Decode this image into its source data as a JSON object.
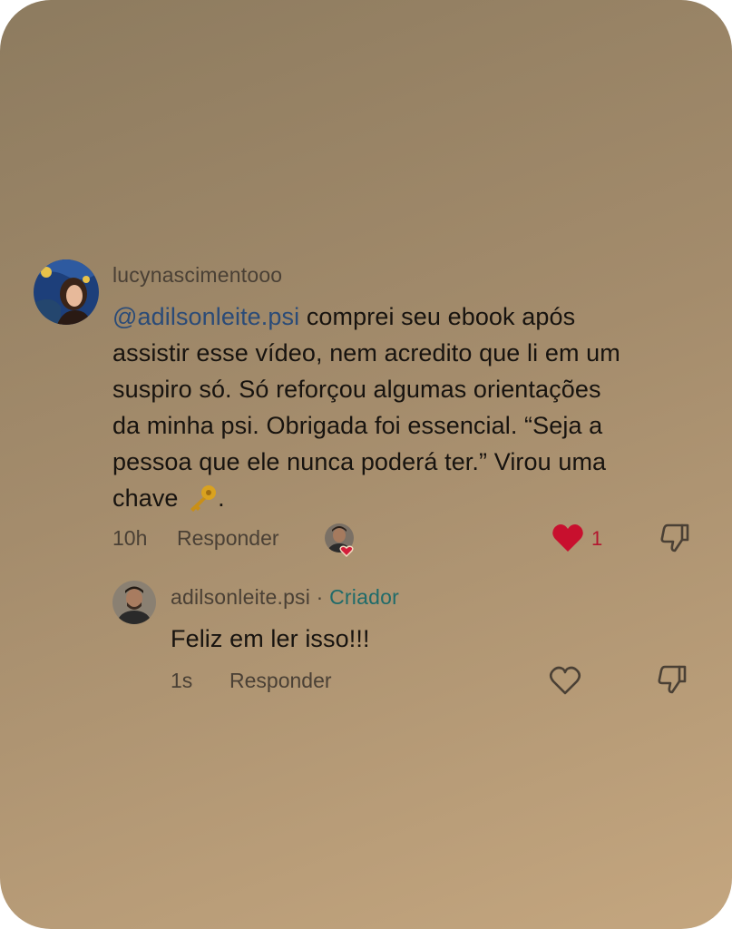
{
  "comment": {
    "username": "lucynascimentooo",
    "mention": "@adilsonleite.psi",
    "text_line1": " comprei seu ebook após",
    "text_line2": "assistir esse vídeo, nem acredito que li em um",
    "text_line3": "suspiro só. Só reforçou algumas orientações",
    "text_line4": "da minha psi. Obrigada foi essencial. “Seja a",
    "text_line5": "pessoa que ele nunca poderá ter.” Virou uma",
    "text_line6_before": "chave ",
    "text_line6_after": ".",
    "emoji": "key",
    "time": "10h",
    "reply_label": "Responder",
    "like_count": "1",
    "liked": true,
    "creator_liked": true
  },
  "reply": {
    "username": "adilsonleite.psi",
    "separator": " · ",
    "badge": "Criador",
    "text": "Feliz em ler isso!!!",
    "time": "1s",
    "reply_label": "Responder",
    "liked": false
  },
  "colors": {
    "mention": "#2a4b78",
    "creator_badge": "#1f6b6a",
    "like_red": "#c8102e"
  }
}
